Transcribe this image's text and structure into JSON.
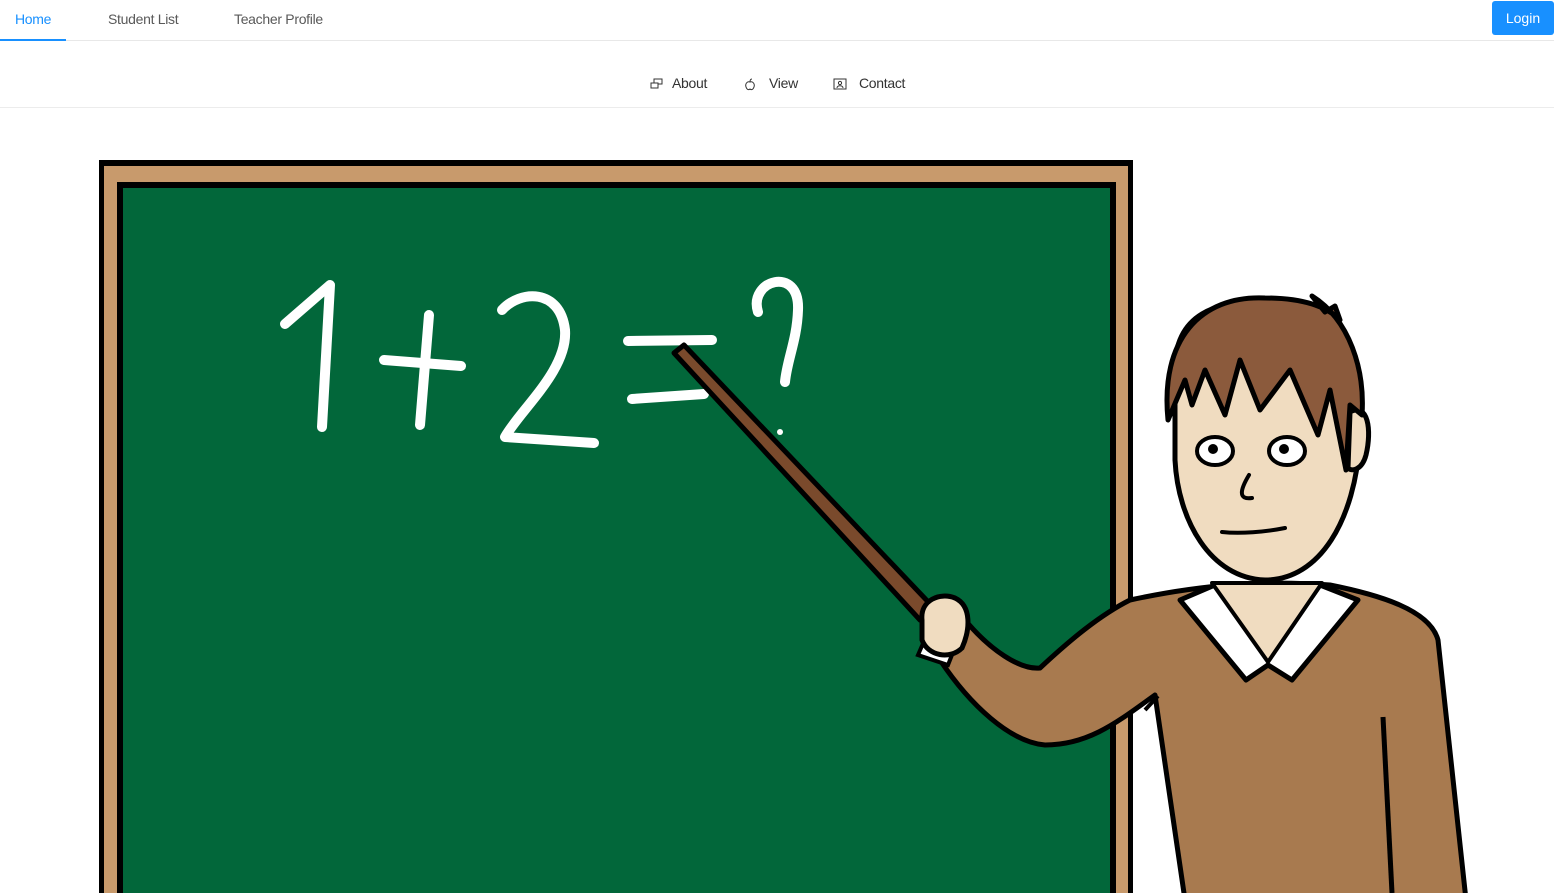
{
  "topnav": {
    "tabs": [
      {
        "label": "Home",
        "active": true
      },
      {
        "label": "Student List",
        "active": false
      },
      {
        "label": "Teacher Profile",
        "active": false
      }
    ],
    "login_label": "Login",
    "accent_color": "#1890ff"
  },
  "subnav": {
    "items": [
      {
        "label": "About",
        "icon": "about-icon"
      },
      {
        "label": "View",
        "icon": "view-icon"
      },
      {
        "label": "Contact",
        "icon": "contact-icon"
      }
    ]
  },
  "hero": {
    "board_text": {
      "digit1": "1",
      "plus": "+",
      "digit2": "2",
      "equals": "=",
      "question": "?"
    },
    "board_color": "#02673a",
    "frame_color": "#c89a6c"
  }
}
